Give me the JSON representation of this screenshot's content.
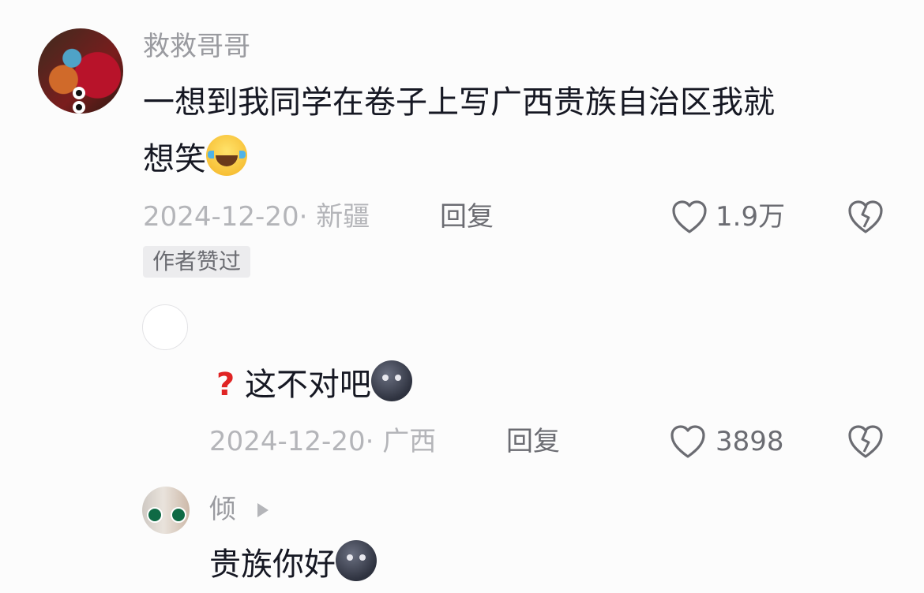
{
  "comment_main": {
    "username": "救救哥哥",
    "text_line1": "一想到我同学在卷子上写广西贵族自治区我就",
    "text_line2": "想笑",
    "emoji": "laughing-tears-icon",
    "date_location": "2024-12-20· 新疆",
    "reply_label": "回复",
    "like_count": "1.9万",
    "badge": "作者赞过"
  },
  "reply_1": {
    "text": "这不对吧",
    "prefix_icon": "question-mark-icon",
    "emoji": "new-moon-face-icon",
    "date_location": "2024-12-20· 广西",
    "reply_label": "回复",
    "like_count": "3898"
  },
  "reply_2": {
    "username": "倾",
    "text": "贵族你好",
    "emoji": "new-moon-face-icon"
  },
  "colors": {
    "background": "#fcfcfc",
    "text_primary": "#161823",
    "text_secondary": "#9a9ba0",
    "question_red": "#e02424"
  }
}
